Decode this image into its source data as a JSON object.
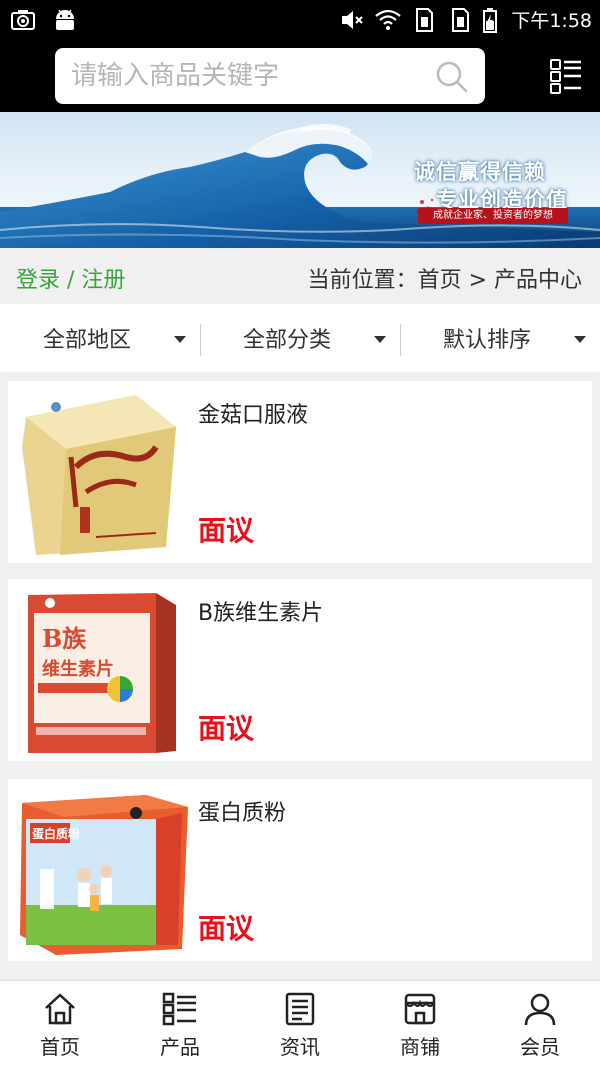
{
  "status_bar": {
    "time": "下午1:58",
    "icons": [
      "camera-icon",
      "android-icon",
      "mute-icon",
      "wifi-icon",
      "sim1-icon",
      "sim2-icon",
      "battery-icon"
    ]
  },
  "search": {
    "placeholder": "请输入商品关键字",
    "icon": "search-icon",
    "menu_icon": "grid-menu-icon"
  },
  "banner": {
    "line1": "诚信赢得信赖",
    "line2": "专业创造价值",
    "sub": "成就企业家、投资者的梦想",
    "colors": {
      "sky": "#e7f1f9",
      "wave": "#1b5f9e",
      "foam": "#ffffff",
      "accent": "#b5121b"
    }
  },
  "location_bar": {
    "login": "登录 / 注册",
    "breadcrumb": "当前位置：首页 > 产品中心",
    "login_color": "#3aa53a"
  },
  "filters": [
    {
      "label": "全部地区"
    },
    {
      "label": "全部分类"
    },
    {
      "label": "默认排序"
    }
  ],
  "products": [
    {
      "name": "金菇口服液",
      "price": "面议",
      "image": "golden-mushroom-box"
    },
    {
      "name": "B族维生素片",
      "price": "面议",
      "image": "vitamin-b-box"
    },
    {
      "name": "蛋白质粉",
      "price": "面议",
      "image": "protein-powder-box"
    }
  ],
  "price_color": "#e8101a",
  "bottom_nav": [
    {
      "label": "首页",
      "icon": "home-icon"
    },
    {
      "label": "产品",
      "icon": "product-list-icon"
    },
    {
      "label": "资讯",
      "icon": "news-icon"
    },
    {
      "label": "商铺",
      "icon": "shop-icon"
    },
    {
      "label": "会员",
      "icon": "member-icon"
    }
  ]
}
